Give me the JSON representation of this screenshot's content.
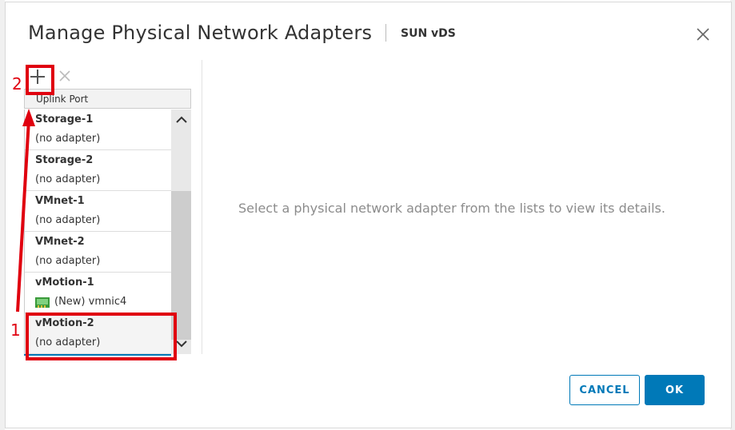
{
  "dialog": {
    "title": "Manage Physical Network Adapters",
    "subtitle": "SUN vDS",
    "close_icon": "close-icon"
  },
  "toolbar": {
    "add_icon": "plus-icon",
    "remove_icon": "x-icon"
  },
  "list": {
    "header": "Uplink Port",
    "rows": [
      {
        "name": "Storage-1",
        "adapter": "(no adapter)"
      },
      {
        "name": "Storage-2",
        "adapter": "(no adapter)"
      },
      {
        "name": "VMnet-1",
        "adapter": "(no adapter)"
      },
      {
        "name": "VMnet-2",
        "adapter": "(no adapter)"
      },
      {
        "name": "vMotion-1",
        "adapter": "(New) vmnic4",
        "adapter_icon": "network-card-icon"
      },
      {
        "name": "vMotion-2",
        "adapter": "(no adapter)",
        "selected": true
      }
    ]
  },
  "details": {
    "placeholder": "Select a physical network adapter from the lists to view its details."
  },
  "footer": {
    "cancel_label": "CANCEL",
    "ok_label": "OK"
  },
  "annotations": {
    "label_1": "1",
    "label_2": "2",
    "color": "#e0000f"
  },
  "colors": {
    "accent": "#0079b8",
    "annotation": "#e0000f"
  }
}
